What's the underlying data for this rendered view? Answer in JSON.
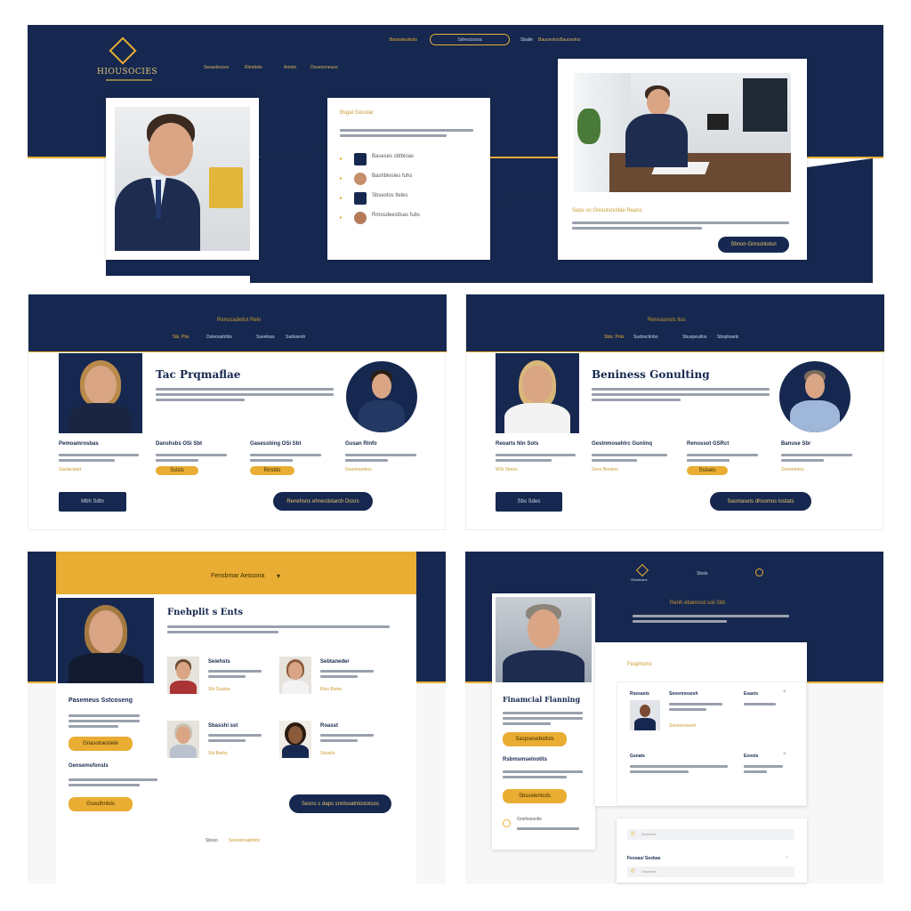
{
  "colors": {
    "navy": "#16284f",
    "gold": "#e9ad33",
    "white": "#ffffff"
  },
  "panel1": {
    "logo_text": "HIOUSOCIES",
    "logo_icon": "diamond-emblem-icon",
    "nav": [
      "Sesasleuces",
      "Rimdrels",
      "Amnin",
      "Doseocneuos"
    ],
    "top_nav": [
      "Basesleulests",
      "Sbaile",
      "Bauceolos"
    ],
    "search_placeholder": "Sdreocisssa",
    "center_card": {
      "title": "Bsgal Gesstar",
      "items": [
        "Baseses sbtbloas",
        "Bashblesles fuhs",
        "Sbseolos tleles",
        "Rmosdeestlsas fubs"
      ]
    },
    "right_card": {
      "title": "Seps sn Gnisutsnctide Reans",
      "button": "Sbnon Gnrsonlotsn"
    }
  },
  "panel2": {
    "header_title": "Renosadetlot Reln",
    "nav": [
      "Sbi. Ptis",
      "Dsteosahtibs",
      "Sseeloas",
      "Sadusesh"
    ],
    "title": "Tac Prqmaflae",
    "cols": [
      {
        "title": "Pemoamrosbas",
        "link": "Gaelaciiaet"
      },
      {
        "title": "Danshsbs OSi Sbt",
        "button": "Sslsls"
      },
      {
        "title": "Gasessbing OSi Sbt",
        "button": "Rnstds"
      },
      {
        "title": "Gusan Rinfo",
        "link": "Geantsaobes"
      }
    ],
    "left_button": "Mbh Sdtn",
    "right_button": "Renehsns ehneclistarch Dosrs"
  },
  "panel3": {
    "header_title": "Renoasnols tlos",
    "nav": [
      "Sbis. Pnts",
      "Sudosctinbo",
      "Sbuspeutlos",
      "Sbsplsaels"
    ],
    "title": "Beniness Gonulting",
    "cols": [
      {
        "title": "Reoarts Nin Sots",
        "link": "WSi Sboss"
      },
      {
        "title": "Gestnmosehlrc Guniinq",
        "link": "Seos Beedos"
      },
      {
        "title": "Renossot GSRct",
        "button": "Sslseis"
      },
      {
        "title": "Banuse Sbr",
        "link": "Gensetoms"
      }
    ],
    "left_button": "Sbs Sdes",
    "right_button": "Sasmasets dhsomos tostats"
  },
  "panel4": {
    "banner_title": "Fensbmar Aessona",
    "title": "Fnehplit s Ents",
    "profile_title": "Pasemeus Sstcoseng",
    "section2_title": "Gensemsfonsls",
    "people": [
      {
        "name": "Seiehsts",
        "link": "Sih Gsatsa"
      },
      {
        "name": "Sebtaneder",
        "link": "Riso Bsets"
      },
      {
        "name": "Sbasshi sst",
        "link": "Sih Brehs"
      },
      {
        "name": "Roasst",
        "link": "Sesnils"
      }
    ],
    "btn1": "Gnasotoestiele",
    "btn2": "Gsouthnlols",
    "right_button": "Sesns s daps snnlsoatnlostotsos",
    "footer": [
      "Sbsso",
      "Sesotsnsabtolts"
    ]
  },
  "panel5": {
    "logo_text": "Sbsstcans",
    "nav_item": "Sbsts",
    "banner_title": "Renh ebannsst ssli Gbt",
    "title": "Finamcial Flanning",
    "section2_title": "Rsbmsmselnotits",
    "btn1": "Saspsesebotlsls",
    "btn2": "Sbsselentcds",
    "contact_title": "Gnehsesolts",
    "card_title": "Fesphsms",
    "table": [
      {
        "c1": "Rsesasts",
        "c2": "Seosnnosesh",
        "c3": "Esasts"
      },
      {
        "c1": "Gsnats",
        "c2": "",
        "c3": "Esosts"
      }
    ],
    "footer_title": "Fesoas/ Sesbas",
    "input1": "Sestsses",
    "input2": "Sesiseos"
  }
}
